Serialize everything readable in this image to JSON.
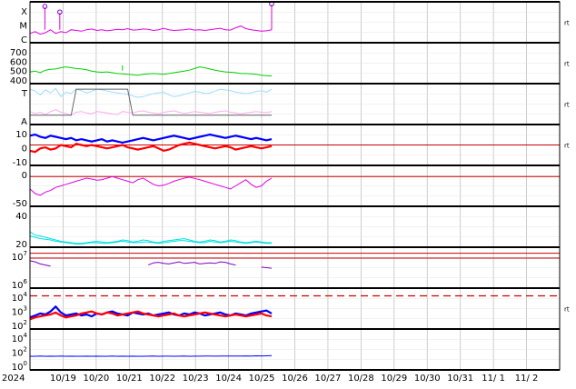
{
  "colors": {
    "frame": "#000000",
    "grid": "#c0c0c0",
    "magenta": "#e000e0",
    "purple": "#8000c0",
    "green": "#00d000",
    "lightblue": "#99ddff",
    "pink": "#ffaaee",
    "gray": "#666666",
    "blue": "#0000ff",
    "red": "#ff0000",
    "cyan": "#00e0e0",
    "darkred": "#cc0000"
  },
  "chart_data": {
    "type": "line",
    "start_date_label": "2024",
    "x_tick_labels": [
      "10/19",
      "10/20",
      "10/21",
      "10/22",
      "10/23",
      "10/24",
      "10/25",
      "10/26",
      "10/27",
      "10/28",
      "10/29",
      "10/30",
      "10/31",
      "11/ 1",
      "11/ 2"
    ],
    "side_marker": "rt",
    "panels": [
      {
        "name": "xray-flare",
        "tick_labels": [
          "X",
          "M",
          "C"
        ],
        "ylim": [
          0,
          1
        ],
        "series": [
          {
            "color": "#e000e0",
            "values": [
              0.2,
              0.25,
              0.18,
              0.22,
              0.3,
              0.2,
              0.25,
              0.22,
              0.3,
              0.28,
              0.26,
              0.3,
              0.32,
              0.28,
              0.3,
              0.27,
              0.29,
              0.31,
              0.3,
              0.33,
              0.29,
              0.3,
              0.32,
              0.31,
              0.28,
              0.3,
              0.34,
              0.3,
              0.28,
              0.29,
              0.3,
              0.32,
              0.29,
              0.3,
              0.28,
              0.3,
              0.32,
              0.34,
              0.3,
              0.29,
              0.35,
              0.4,
              0.33,
              0.3,
              0.28,
              0.26,
              0.27,
              0.3
            ]
          }
        ],
        "spikes": [
          {
            "x": 0.5,
            "peak": 0.9
          },
          {
            "x": 1.0,
            "peak": 0.75
          },
          {
            "x": 8.1,
            "peak": 0.97
          }
        ]
      },
      {
        "name": "solar-wind-speed",
        "tick_labels": [
          "700",
          "600",
          "500",
          "400"
        ],
        "ylim": [
          300,
          750
        ],
        "series": [
          {
            "color": "#00d000",
            "values": [
              420,
              430,
              410,
              440,
              450,
              455,
              470,
              480,
              470,
              460,
              455,
              445,
              430,
              420,
              415,
              420,
              410,
              400,
              395,
              390,
              385,
              380,
              390,
              395,
              400,
              395,
              390,
              400,
              410,
              420,
              430,
              440,
              460,
              480,
              470,
              455,
              440,
              430,
              420,
              415,
              410,
              400,
              400,
              395,
              390,
              380,
              375,
              370
            ]
          }
        ],
        "spikes": [
          {
            "x": 3.1,
            "peak": 500
          }
        ]
      },
      {
        "name": "temperature-alpha",
        "tick_labels": [
          "T",
          "A"
        ],
        "ylim": [
          0,
          1
        ],
        "series": [
          {
            "color": "#99ddff",
            "values": [
              0.9,
              0.85,
              0.75,
              0.88,
              0.8,
              0.92,
              0.7,
              0.82,
              0.78,
              0.9,
              0.86,
              0.8,
              0.84,
              0.9,
              0.88,
              0.85,
              0.82,
              0.8,
              0.78,
              0.76,
              0.72,
              0.68,
              0.7,
              0.74,
              0.78,
              0.8,
              0.82,
              0.75,
              0.7,
              0.72,
              0.76,
              0.8,
              0.84,
              0.82,
              0.78,
              0.8,
              0.85,
              0.9,
              0.88,
              0.86,
              0.82,
              0.8,
              0.78,
              0.8,
              0.84,
              0.86,
              0.82,
              0.9
            ]
          },
          {
            "color": "#ffaaee",
            "values": [
              0.3,
              0.25,
              0.28,
              0.22,
              0.3,
              0.35,
              0.28,
              0.25,
              0.2,
              0.28,
              0.3,
              0.26,
              0.24,
              0.3,
              0.28,
              0.26,
              0.24,
              0.22,
              0.3,
              0.28,
              0.26,
              0.3,
              0.32,
              0.28,
              0.26,
              0.24,
              0.28,
              0.3,
              0.32,
              0.28,
              0.25,
              0.27,
              0.3,
              0.28,
              0.26,
              0.25,
              0.28,
              0.3,
              0.32,
              0.28,
              0.26,
              0.24,
              0.26,
              0.28,
              0.3,
              0.28,
              0.27,
              0.3
            ]
          },
          {
            "color": "#666666",
            "values": [
              0.2,
              0.2,
              0.2,
              0.2,
              0.2,
              0.2,
              0.2,
              0.2,
              0.2,
              0.9,
              0.9,
              0.9,
              0.9,
              0.9,
              0.9,
              0.9,
              0.9,
              0.9,
              0.9,
              0.9,
              0.2,
              0.2,
              0.2,
              0.2,
              0.2,
              0.2,
              0.2,
              0.2,
              0.2,
              0.2,
              0.2,
              0.2,
              0.2,
              0.2,
              0.2,
              0.2,
              0.2,
              0.2,
              0.2,
              0.2,
              0.2,
              0.2,
              0.2,
              0.2,
              0.2,
              0.2,
              0.2,
              0.2
            ]
          }
        ]
      },
      {
        "name": "magnetic-field",
        "tick_labels": [
          "10",
          "0",
          "-10"
        ],
        "ylim": [
          -16,
          16
        ],
        "refline": 0,
        "series": [
          {
            "color": "#0000ff",
            "values": [
              8,
              9,
              7,
              6,
              8,
              7,
              6,
              5,
              6,
              4,
              5,
              4,
              3,
              4,
              5,
              3,
              4,
              3,
              2,
              3,
              4,
              5,
              6,
              5,
              4,
              5,
              6,
              7,
              8,
              7,
              6,
              5,
              6,
              7,
              8,
              9,
              8,
              7,
              6,
              7,
              8,
              7,
              6,
              5,
              6,
              5,
              4,
              5
            ]
          },
          {
            "color": "#ff0000",
            "values": [
              -5,
              -6,
              -3,
              -2,
              -4,
              -3,
              0,
              -1,
              -2,
              1,
              0,
              -1,
              0,
              -1,
              -2,
              -3,
              -2,
              -1,
              0,
              -2,
              -3,
              -4,
              -3,
              -2,
              -1,
              -3,
              -5,
              -4,
              -2,
              0,
              1,
              2,
              1,
              0,
              -1,
              -2,
              -3,
              -2,
              -1,
              -2,
              -4,
              -3,
              -2,
              -1,
              -2,
              -3,
              -2,
              -1
            ]
          }
        ]
      },
      {
        "name": "dst-index",
        "tick_labels": [
          "0",
          "-50"
        ],
        "ylim": [
          -90,
          30
        ],
        "refline": 0,
        "series": [
          {
            "color": "#e000e0",
            "values": [
              -40,
              -55,
              -60,
              -50,
              -45,
              -35,
              -30,
              -25,
              -20,
              -15,
              -10,
              -5,
              -8,
              -12,
              -10,
              -5,
              0,
              -5,
              -10,
              -15,
              -20,
              -10,
              -5,
              -15,
              -25,
              -30,
              -28,
              -22,
              -15,
              -10,
              -5,
              -2,
              -6,
              -10,
              -15,
              -20,
              -25,
              -30,
              -35,
              -40,
              -30,
              -20,
              -10,
              -25,
              -35,
              -30,
              -15,
              -5
            ]
          }
        ]
      },
      {
        "name": "kp-index",
        "tick_labels": [
          "40",
          "20"
        ],
        "ylim": [
          0,
          55
        ],
        "series": [
          {
            "color": "#00e0e0",
            "values": [
              20,
              15,
              14,
              12,
              10,
              8,
              6,
              5,
              4,
              3,
              3,
              4,
              5,
              6,
              5,
              4,
              5,
              6,
              8,
              7,
              5,
              6,
              8,
              7,
              5,
              4,
              6,
              7,
              8,
              9,
              10,
              8,
              6,
              5,
              6,
              8,
              7,
              5,
              6,
              8,
              7,
              5,
              4,
              5,
              6,
              5,
              4,
              4
            ]
          },
          {
            "color": "#00e0e0",
            "values": [
              14,
              12,
              10,
              9,
              8,
              6,
              5,
              4,
              3,
              2,
              2,
              3,
              4,
              4,
              3,
              3,
              4,
              5,
              6,
              5,
              4,
              4,
              5,
              5,
              4,
              3,
              4,
              5,
              6,
              7,
              7,
              6,
              5,
              4,
              4,
              6,
              5,
              4,
              5,
              6,
              5,
              4,
              3,
              4,
              5,
              4,
              3,
              3
            ]
          }
        ]
      },
      {
        "name": "proton-flux",
        "tick_labels": [
          "10^7",
          "10^6"
        ],
        "ylim": [
          1,
          8
        ],
        "reflines": [
          7.2,
          6.3
        ],
        "series": [
          {
            "color": "#8000c0",
            "values": [
              5.8,
              5.6,
              5.2,
              5.0,
              4.8,
              null,
              null,
              null,
              null,
              null,
              null,
              null,
              null,
              null,
              null,
              null,
              null,
              null,
              null,
              null,
              null,
              null,
              null,
              5.0,
              5.4,
              5.5,
              5.3,
              5.2,
              5.4,
              5.6,
              5.3,
              5.4,
              5.5,
              5.2,
              5.3,
              5.4,
              5.3,
              5.6,
              5.5,
              5.2,
              5.0,
              null,
              null,
              null,
              null,
              4.6,
              4.5,
              4.4
            ]
          }
        ]
      },
      {
        "name": "electron-flux",
        "tick_labels": [
          "10^4",
          "10^3",
          "10^2"
        ],
        "ylim": [
          0.8,
          4.6
        ],
        "dashed_refline": 4.0,
        "series": [
          {
            "color": "#0000ff",
            "values": [
              1.8,
              2.0,
              2.2,
              2.1,
              2.4,
              2.9,
              2.3,
              2.0,
              2.1,
              2.2,
              2.0,
              2.1,
              1.9,
              2.2,
              2.1,
              2.3,
              2.4,
              2.2,
              2.1,
              2.0,
              2.3,
              2.2,
              2.1,
              2.2,
              2.0,
              2.1,
              2.2,
              2.3,
              2.1,
              2.0,
              2.2,
              2.1,
              2.3,
              2.2,
              2.0,
              2.1,
              2.2,
              2.3,
              2.1,
              2.0,
              2.2,
              2.1,
              2.0,
              2.2,
              2.3,
              2.4,
              2.5,
              2.2
            ]
          },
          {
            "color": "#ff0000",
            "values": [
              1.6,
              1.8,
              1.9,
              2.0,
              2.1,
              2.3,
              2.0,
              1.8,
              1.9,
              2.0,
              2.2,
              2.3,
              2.4,
              2.2,
              2.1,
              2.3,
              2.2,
              2.0,
              2.1,
              2.2,
              2.3,
              2.4,
              2.2,
              2.1,
              2.0,
              1.9,
              2.0,
              2.1,
              2.2,
              2.0,
              1.9,
              2.0,
              2.1,
              2.2,
              2.3,
              2.2,
              2.1,
              2.0,
              1.9,
              2.0,
              2.1,
              2.0,
              1.9,
              2.0,
              2.1,
              2.2,
              2.0,
              1.9
            ]
          }
        ]
      },
      {
        "name": "neutron-flux",
        "tick_labels": [
          "10^4",
          "10^2",
          "10^0"
        ],
        "ylim": [
          -1,
          5
        ],
        "series": [
          {
            "color": "#0000ff",
            "values": [
              0.9,
              0.9,
              0.95,
              0.9,
              0.92,
              0.9,
              0.93,
              0.9,
              0.92,
              0.9,
              0.9,
              0.91,
              0.9,
              0.92,
              0.9,
              0.9,
              0.93,
              0.9,
              0.91,
              0.9,
              0.92,
              0.9,
              0.9,
              0.91,
              0.93,
              0.9,
              0.92,
              0.91,
              0.9,
              0.92,
              0.93,
              0.9,
              0.91,
              0.92,
              0.93,
              0.94,
              0.92,
              0.93,
              0.95,
              0.94,
              0.93,
              0.95,
              0.96,
              0.95,
              0.97,
              0.96,
              0.98,
              1.0
            ]
          }
        ]
      }
    ]
  }
}
